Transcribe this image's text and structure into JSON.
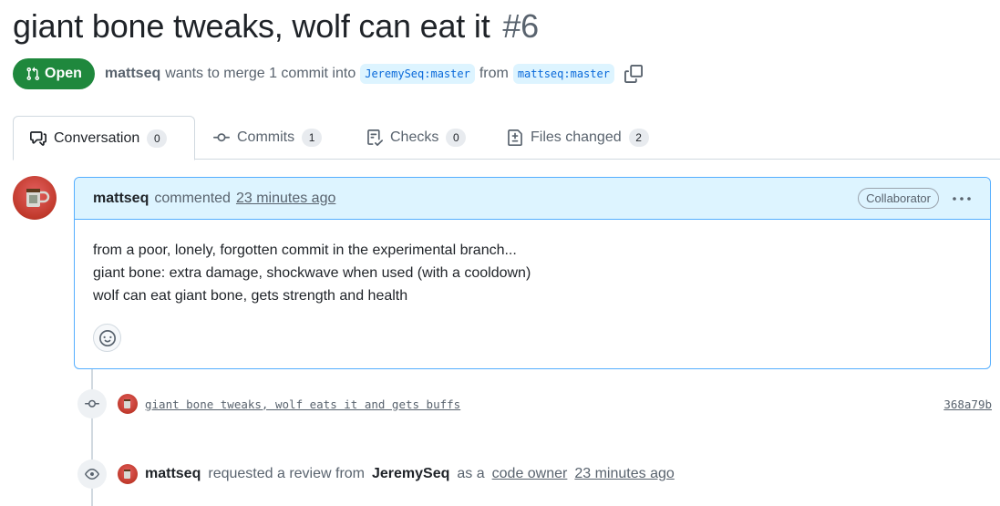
{
  "pr": {
    "title": "giant bone tweaks, wolf can eat it",
    "number": "#6",
    "state": "Open",
    "author": "mattseq",
    "merge_text_1": "wants to merge 1 commit into",
    "base_branch": "JeremySeq:master",
    "merge_text_2": "from",
    "head_branch": "mattseq:master"
  },
  "tabs": [
    {
      "label": "Conversation",
      "count": "0",
      "icon": "comment-discussion-icon"
    },
    {
      "label": "Commits",
      "count": "1",
      "icon": "git-commit-icon"
    },
    {
      "label": "Checks",
      "count": "0",
      "icon": "checklist-icon"
    },
    {
      "label": "Files changed",
      "count": "2",
      "icon": "file-diff-icon"
    }
  ],
  "comment": {
    "author": "mattseq",
    "action": "commented",
    "time": "23 minutes ago",
    "role": "Collaborator",
    "body": [
      "from a poor, lonely, forgotten commit in the experimental branch...",
      "giant bone: extra damage, shockwave when used (with a cooldown)",
      "wolf can eat giant bone, gets strength and health"
    ]
  },
  "timeline": {
    "commit": {
      "message": "giant bone tweaks, wolf eats it and gets buffs",
      "sha": "368a79b"
    },
    "review": {
      "actor": "mattseq",
      "text_1": "requested a review from",
      "reviewer": "JeremySeq",
      "text_2": "as a",
      "link": "code owner",
      "time": "23 minutes ago"
    }
  },
  "colors": {
    "open_green": "#1f883d",
    "accent_blue": "#0969da",
    "header_blue": "#ddf4ff"
  }
}
